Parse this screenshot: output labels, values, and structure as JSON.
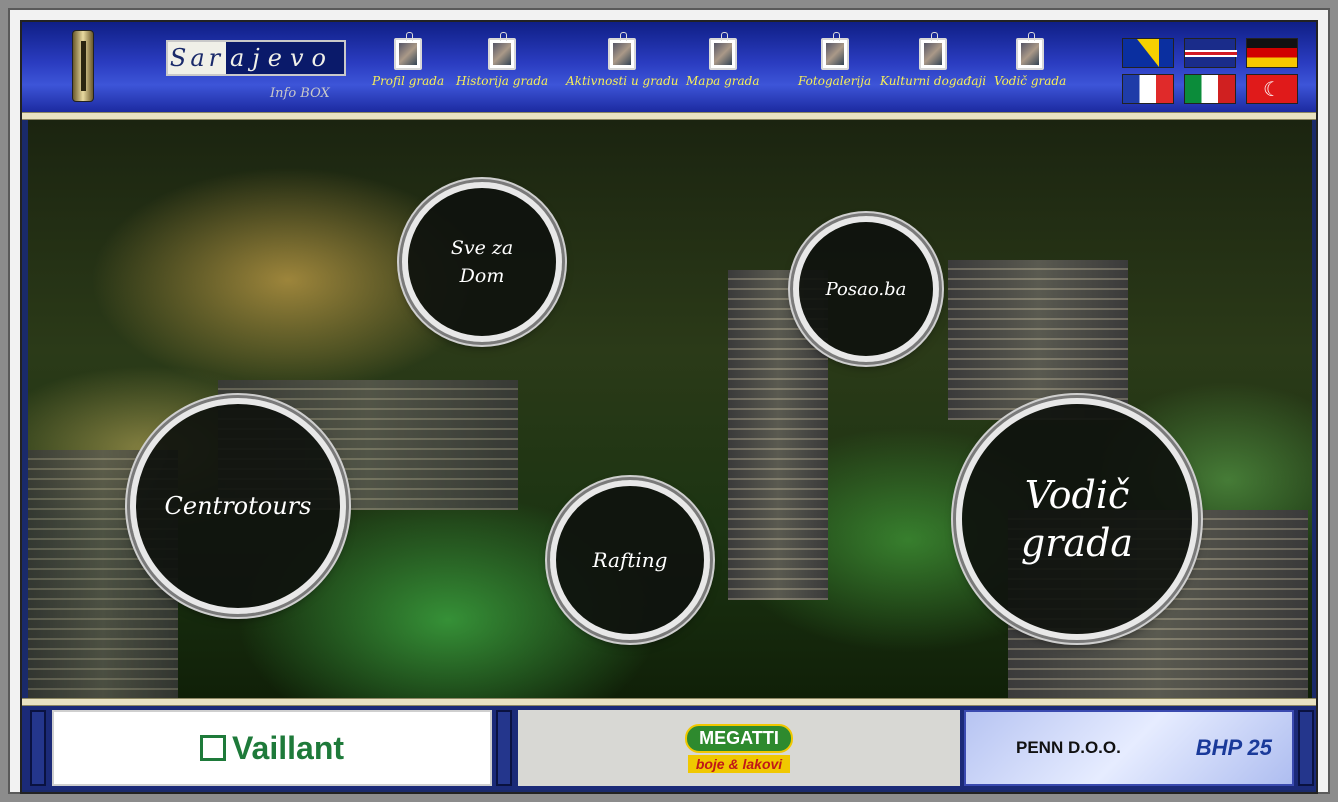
{
  "header": {
    "logo": {
      "left": "Sar",
      "right": "ajevo",
      "sub": "Info BOX"
    },
    "nav": [
      {
        "label": "Profil grada"
      },
      {
        "label": "Historija grada"
      },
      {
        "label": "Aktivnosti u gradu"
      },
      {
        "label": "Mapa grada"
      },
      {
        "label": "Fotogalerija"
      },
      {
        "label": "Kulturni događaji"
      },
      {
        "label": "Vodič grada"
      }
    ],
    "flags": [
      "flag-bosnia-icon",
      "flag-uk-icon",
      "flag-germany-icon",
      "flag-france-icon",
      "flag-italy-icon",
      "flag-turkey-icon"
    ]
  },
  "circles": {
    "sve_za_dom": {
      "line1": "Sve za",
      "line2": "Dom"
    },
    "posao": "Posao.ba",
    "centrotours": "Centrotours",
    "rafting": "Rafting",
    "vodic": {
      "line1": "Vodič",
      "line2": "grada"
    }
  },
  "footer": {
    "vaillant": "Vaillant",
    "megatti": {
      "top": "MEGATTI",
      "bottom": "boje & lakovi"
    },
    "penn": "PENN D.O.O.",
    "bhp": "BHP 25"
  },
  "colors": {
    "nav_text": "#f6ee5a",
    "header_bg": "#2a3cc0",
    "circle_border": "#e8e8e8"
  }
}
